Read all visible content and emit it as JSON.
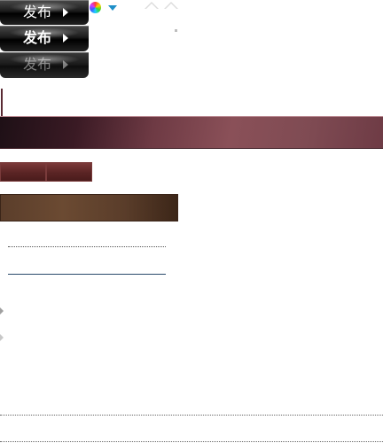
{
  "publish_buttons": [
    {
      "label": "发布",
      "state": "normal"
    },
    {
      "label": "发布",
      "state": "hover"
    },
    {
      "label": "发布",
      "state": "disabled"
    }
  ],
  "icons": {
    "color_picker": "color-wheel-icon",
    "dropdown": "dropdown-arrow-icon",
    "collapse_left": "caret-up-icon",
    "collapse_right": "caret-up-icon"
  },
  "colors": {
    "banner": "#7f4b53",
    "tab": "#5a2424",
    "brown_bar": "#6b4a32",
    "dropdown_accent": "#1e8fc8"
  }
}
